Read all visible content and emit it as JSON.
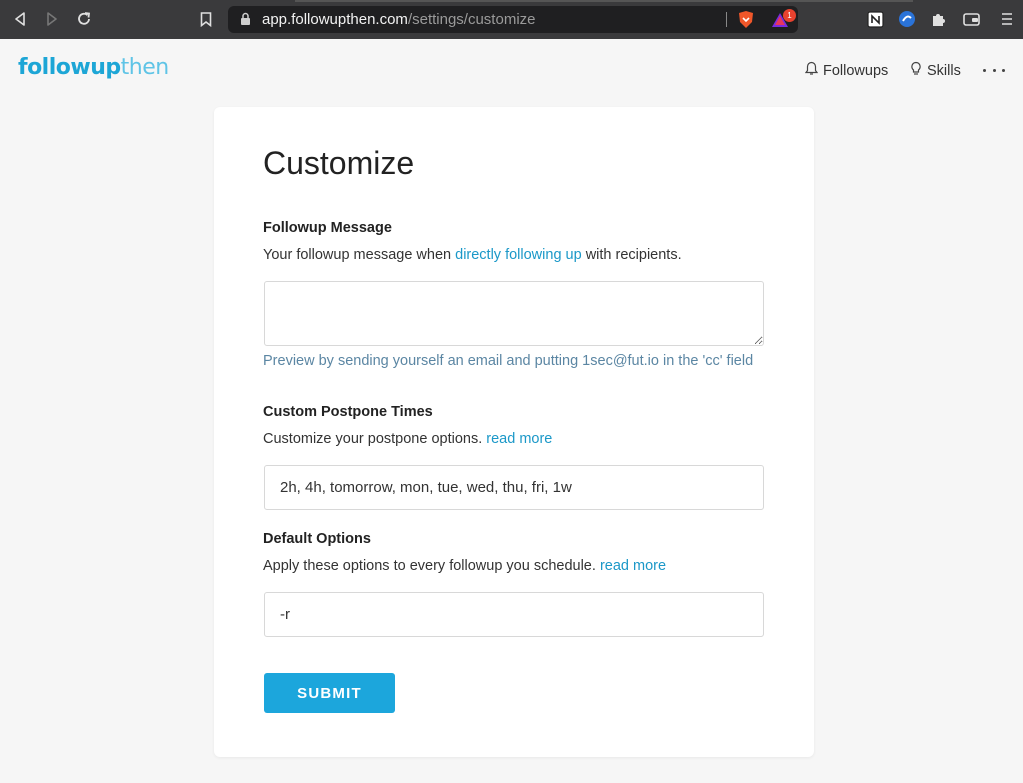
{
  "browser": {
    "url_host": "app.followupthen.com",
    "url_path": "/settings/customize",
    "notification_count": "1",
    "icons": [
      "back-icon",
      "forward-icon",
      "reload-icon",
      "bookmark-icon",
      "lock-icon",
      "brave-shield-icon",
      "brave-rewards-icon",
      "notion-icon",
      "extension-icon",
      "puzzle-icon",
      "wallet-icon",
      "menu-icon"
    ]
  },
  "header": {
    "logo_part1": "followup",
    "logo_part2": "then",
    "nav": [
      {
        "label": "Followups",
        "icon": "bell-icon"
      },
      {
        "label": "Skills",
        "icon": "lightbulb-icon"
      }
    ]
  },
  "page": {
    "title": "Customize",
    "followup_message": {
      "label": "Followup Message",
      "desc_before": "Your followup message when ",
      "desc_link": "directly following up",
      "desc_after": " with recipients.",
      "value": "",
      "hint": "Preview by sending yourself an email and putting 1sec@fut.io in the 'cc' field"
    },
    "postpone_times": {
      "label": "Custom Postpone Times",
      "desc": "Customize your postpone options. ",
      "link": "read more",
      "value": "2h, 4h, tomorrow, mon, tue, wed, thu, fri, 1w"
    },
    "default_options": {
      "label": "Default Options",
      "desc": "Apply these options to every followup you schedule. ",
      "link": "read more",
      "value": "-r"
    },
    "submit_label": "SUBMIT"
  },
  "colors": {
    "accent": "#1ca6dc",
    "link": "#1b98c8",
    "hint": "#5b86a3",
    "chrome": "#3a3a3c"
  }
}
